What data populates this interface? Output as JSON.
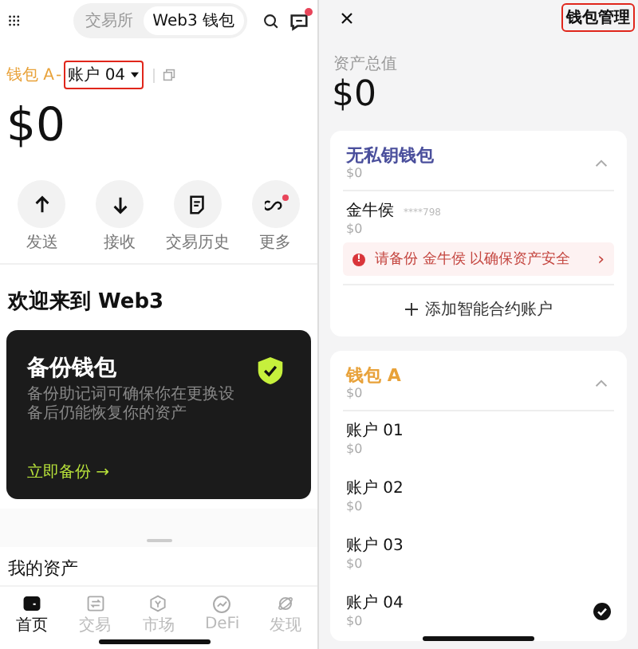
{
  "home": {
    "segments": [
      {
        "label": "交易所",
        "selected": false
      },
      {
        "label": "Web3 钱包",
        "selected": true
      }
    ],
    "notification_dot": true,
    "wallet_name": "钱包 A",
    "separator": "-",
    "account": {
      "label": "账户 04",
      "highlighted": true
    },
    "balance": "$0",
    "actions": [
      {
        "kind": "send",
        "label": "发送",
        "badge": false
      },
      {
        "kind": "receive",
        "label": "接收",
        "badge": false
      },
      {
        "kind": "history",
        "label": "交易历史",
        "badge": false
      },
      {
        "kind": "more",
        "label": "更多",
        "badge": true
      }
    ],
    "welcome": "欢迎来到 Web3",
    "backup_card": {
      "title": "备份钱包",
      "description": "备份助记词可确保你在更换设备后仍能恢复你的资产",
      "link": "立即备份",
      "arrow": "→"
    },
    "assets_title": "我的资产",
    "tabs": [
      {
        "kind": "home",
        "label": "首页",
        "selected": true
      },
      {
        "kind": "trade",
        "label": "交易",
        "selected": false
      },
      {
        "kind": "market",
        "label": "市场",
        "selected": false
      },
      {
        "kind": "defi",
        "label": "DeFi",
        "selected": false
      },
      {
        "kind": "discover",
        "label": "发现",
        "selected": false
      }
    ]
  },
  "manage": {
    "manage_button": {
      "label": "钱包管理",
      "highlighted": true
    },
    "total_label": "资产总值",
    "total": "$0",
    "groups": [
      {
        "kind": "keyless",
        "name": "无私钥钱包",
        "balance": "$0",
        "expanded": true,
        "accounts": [
          {
            "name": "金牛侯",
            "address": "****798",
            "balance": "$0",
            "selected": false
          }
        ],
        "warning": {
          "icon": "!",
          "text": "请备份 金牛侯 以确保资产安全",
          "chevron": "›"
        },
        "add_label": "添加智能合约账户"
      },
      {
        "kind": "seed",
        "name": "钱包 A",
        "balance": "$0",
        "expanded": true,
        "accounts": [
          {
            "name": "账户 01",
            "balance": "$0",
            "selected": false
          },
          {
            "name": "账户 02",
            "balance": "$0",
            "selected": false
          },
          {
            "name": "账户 03",
            "balance": "$0",
            "selected": false
          },
          {
            "name": "账户 04",
            "balance": "$0",
            "selected": true
          }
        ]
      }
    ]
  }
}
